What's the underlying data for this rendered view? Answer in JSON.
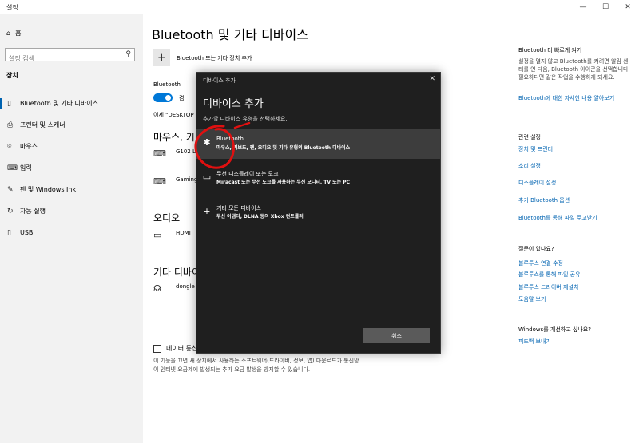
{
  "window": {
    "title": "설정",
    "minimize": "—",
    "maximize": "☐",
    "close": "✕"
  },
  "sidebar": {
    "home": "홈",
    "search_placeholder": "설정 검색",
    "section": "장치",
    "items": [
      {
        "label": "Bluetooth 및 기타 디바이스",
        "icon": "bluetooth-devices-icon",
        "glyph": "▯"
      },
      {
        "label": "프린터 및 스캐너",
        "icon": "printer-icon",
        "glyph": "⎙"
      },
      {
        "label": "마우스",
        "icon": "mouse-icon",
        "glyph": "⌾"
      },
      {
        "label": "입력",
        "icon": "keyboard-icon",
        "glyph": "⌨"
      },
      {
        "label": "펜 및 Windows Ink",
        "icon": "pen-icon",
        "glyph": "✎"
      },
      {
        "label": "자동 실행",
        "icon": "autoplay-icon",
        "glyph": "↻"
      },
      {
        "label": "USB",
        "icon": "usb-icon",
        "glyph": "▯"
      }
    ]
  },
  "main": {
    "title": "Bluetooth 및 기타 디바이스",
    "add_device_label": "Bluetooth 또는 기타 장치 추가",
    "bluetooth_label": "Bluetooth",
    "toggle_text": "켬",
    "discover_text": "이제 \"DESKTOP",
    "mouse_heading": "마우스, 키",
    "mouse_devices": [
      "G102 L",
      "Gaming"
    ],
    "audio_heading": "오디오",
    "audio_devices": [
      "HDMI"
    ],
    "other_heading": "기타 디바이",
    "other_devices": [
      "dongle"
    ],
    "checkbox_label": "데이터 통신",
    "note": "이 기능을 끄면 새 장치에서 사용하는 소프트웨어(드라이버, 정보, 앱) 다운로드가 통신망이 인터넷 요금제에 발생되는 추가 요금 발생을 방지할 수 있습니다."
  },
  "right": {
    "quick_title": "Bluetooth 더 빠르게 켜기",
    "quick_text": "설정을 열지 않고 Bluetooth를 켜려면 알림 센터를 연 다음, Bluetooth 아이콘을 선택합니다. 필요하다면 같은 작업을 수행하게 되세요.",
    "quick_link": "Bluetooth에 대한 자세한 내용 알아보기",
    "related_title": "관련 설정",
    "related_links": [
      "장치 및 프린터",
      "소리 설정",
      "디스플레이 설정",
      "추가 Bluetooth 옵션",
      "Bluetooth를 통해 파일 주고받기"
    ],
    "question_title": "질문이 있나요?",
    "question_links": [
      "블루투스 연결 수정",
      "블루투스를 통해 파일 공유",
      "블루투스 드라이버 재설치",
      "도움말 보기"
    ],
    "improve_title": "Windows를 개선하고 싶나요?",
    "improve_link": "피드백 보내기"
  },
  "dialog": {
    "window_title": "디바이스 추가",
    "close": "✕",
    "heading": "디바이스 추가",
    "subtitle": "추가할 디바이스 유형을 선택하세요.",
    "options": [
      {
        "title": "Bluetooth",
        "desc": "마우스, 키보드, 펜, 오디오 및 기타 유형의 Bluetooth 디바이스",
        "icon": "bluetooth-icon",
        "glyph": "✱"
      },
      {
        "title": "무선 디스플레이 또는 도크",
        "desc": "Miracast 또는 무선 도크를 사용하는 무선 모니터, TV 또는 PC",
        "icon": "monitor-icon",
        "glyph": "▭"
      },
      {
        "title": "기타 모든 디바이스",
        "desc": "무선 어댑터, DLNA 등의 Xbox 컨트롤러",
        "icon": "plus-icon",
        "glyph": "+"
      }
    ],
    "cancel": "취소"
  },
  "colors": {
    "accent": "#0078d7",
    "link": "#0063b1",
    "dialog_bg": "#1f1f1f",
    "annotation": "#e01010"
  }
}
